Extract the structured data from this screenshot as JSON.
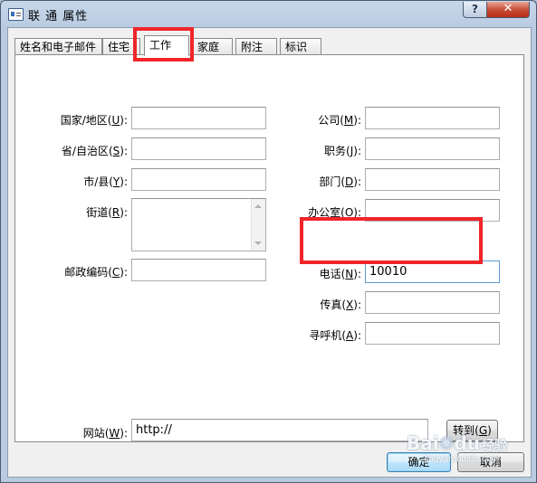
{
  "window": {
    "title": "联 通 属性",
    "help_label": "?",
    "close_label": "✕"
  },
  "tabs": [
    {
      "label": "姓名和电子邮件"
    },
    {
      "label": "住宅"
    },
    {
      "label": "工作"
    },
    {
      "label": "家庭"
    },
    {
      "label": "附注"
    },
    {
      "label": "标识"
    }
  ],
  "fields_left": {
    "country": {
      "label": "国家/地区(",
      "key": "U",
      "tail": "):",
      "value": ""
    },
    "province": {
      "label": "省/自治区(",
      "key": "S",
      "tail": "):",
      "value": ""
    },
    "city": {
      "label": "市/县(",
      "key": "Y",
      "tail": "):",
      "value": ""
    },
    "street": {
      "label": "街道(",
      "key": "R",
      "tail": "):",
      "value": ""
    },
    "postal": {
      "label": "邮政编码(",
      "key": "C",
      "tail": "):",
      "value": ""
    }
  },
  "fields_right": {
    "company": {
      "label": "公司(",
      "key": "M",
      "tail": "):",
      "value": ""
    },
    "job": {
      "label": "职务(",
      "key": "J",
      "tail": "):",
      "value": ""
    },
    "department": {
      "label": "部门(",
      "key": "D",
      "tail": "):",
      "value": ""
    },
    "office": {
      "label": "办公室(",
      "key": "O",
      "tail": "):",
      "value": ""
    },
    "phone": {
      "label": "电话(",
      "key": "N",
      "tail": "):",
      "value": "10010"
    },
    "fax": {
      "label": "传真(",
      "key": "X",
      "tail": "):",
      "value": ""
    },
    "pager": {
      "label": "寻呼机(",
      "key": "A",
      "tail": "):",
      "value": ""
    }
  },
  "website": {
    "label": "网站(",
    "key": "W",
    "tail": "):",
    "value": "http://",
    "go_label": "转到(",
    "go_key": "G",
    "go_tail": ")"
  },
  "footer": {
    "ok_label": "确定",
    "cancel_label": "取消"
  },
  "watermark": {
    "text1": "Bai",
    "text2": "du",
    "text3": "经验",
    "text4": "jingyan.baidu.com"
  },
  "colors": {
    "highlight": "#f0252a",
    "titlebar": "#b9cbe1"
  }
}
